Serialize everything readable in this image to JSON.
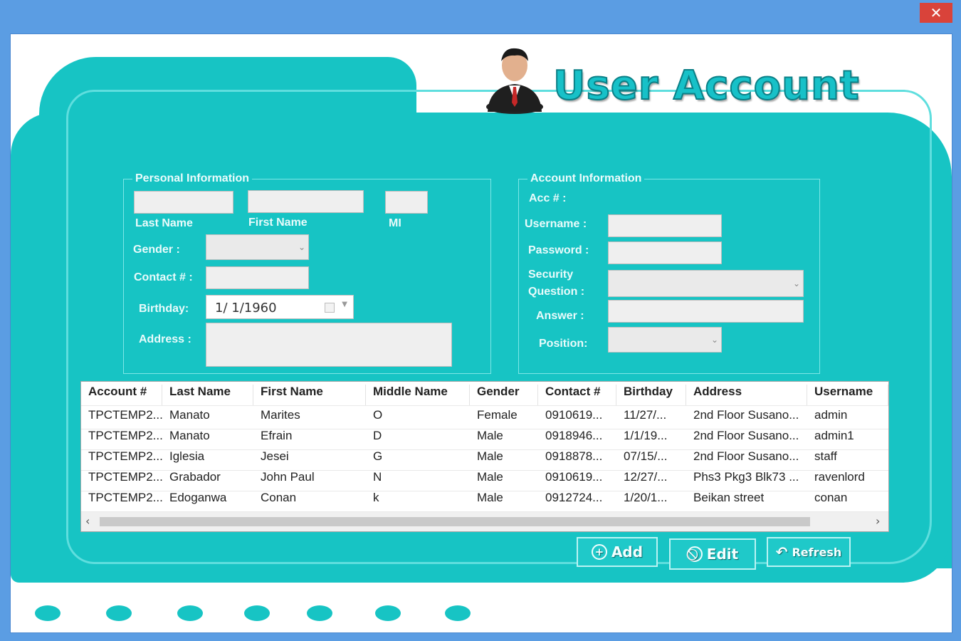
{
  "window": {
    "close_label": "✕"
  },
  "header": {
    "title": "User Account",
    "avatar_icon": "user-avatar-icon"
  },
  "personal": {
    "group_title": "Personal Information",
    "last_name_label": "Last Name",
    "first_name_label": "First Name",
    "mi_label": "MI",
    "gender_label": "Gender :",
    "contact_label": "Contact # :",
    "birthday_label": "Birthday:",
    "birthday_value": "1/  1/1960",
    "address_label": "Address :"
  },
  "account": {
    "group_title": "Account Information",
    "acc_label": "Acc # :",
    "username_label": "Username :",
    "password_label": "Password :",
    "security_label_1": "Security",
    "security_label_2": "Question :",
    "answer_label": "Answer :",
    "position_label": "Position:"
  },
  "table": {
    "columns": [
      "Account #",
      "Last Name",
      "First Name",
      "Middle Name",
      "Gender",
      "Contact #",
      "Birthday",
      "Address",
      "Username"
    ],
    "rows": [
      [
        "TPCTEMP2...",
        "Manato",
        "Marites",
        "O",
        "Female",
        "0910619...",
        "11/27/...",
        "2nd Floor Susano...",
        "admin"
      ],
      [
        "TPCTEMP2...",
        "Manato",
        "Efrain",
        "D",
        "Male",
        "0918946...",
        "1/1/19...",
        "2nd Floor Susano...",
        "admin1"
      ],
      [
        "TPCTEMP2...",
        "Iglesia",
        "Jesei",
        "G",
        "Male",
        "0918878...",
        "07/15/...",
        "2nd Floor Susano...",
        "staff"
      ],
      [
        "TPCTEMP2...",
        "Grabador",
        "John Paul",
        "N",
        "Male",
        "0910619...",
        "12/27/...",
        "Phs3 Pkg3 Blk73 ...",
        "ravenlord"
      ],
      [
        "TPCTEMP2...",
        "Edoganwa",
        "Conan",
        "k",
        "Male",
        "0912724...",
        "1/20/1...",
        "Beikan street",
        "conan"
      ]
    ]
  },
  "buttons": {
    "add": "Add",
    "edit": "Edit",
    "refresh": "Refresh"
  },
  "colors": {
    "accent": "#17c4c4",
    "title_bar": "#5b9de3",
    "close": "#d9433a"
  }
}
